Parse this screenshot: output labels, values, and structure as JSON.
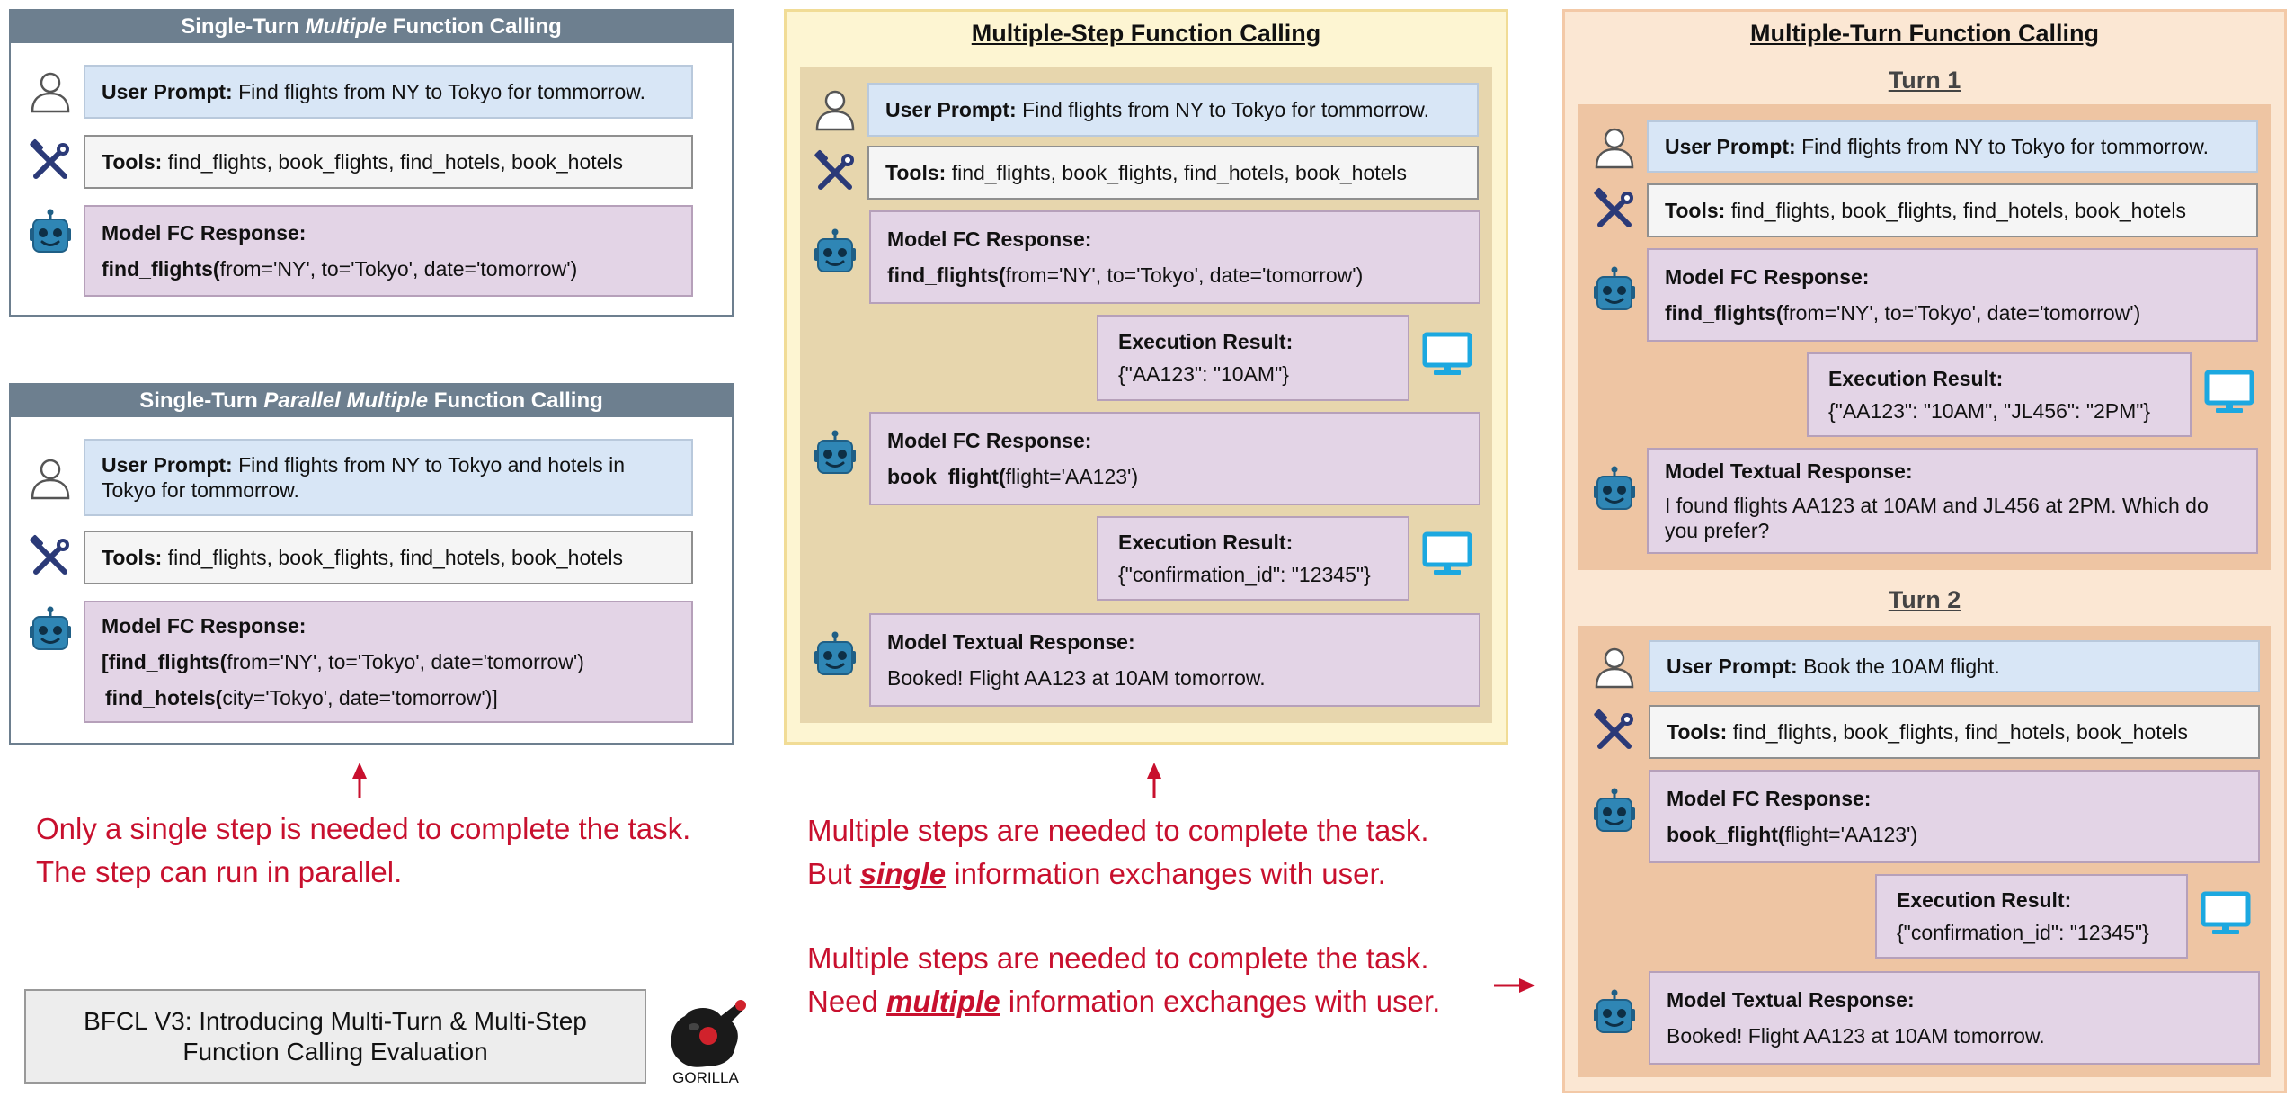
{
  "colors": {
    "note_red": "#c8102e",
    "robot_blue": "#2f86b5",
    "monitor_cyan": "#1ca8e0",
    "tools_navy": "#2b3a78",
    "card_header": "#6d7f8f"
  },
  "icons": {
    "user": "user-icon",
    "tools": "tools-icon",
    "robot": "robot-icon",
    "monitor": "monitor-icon",
    "gorilla": "gorilla-logo"
  },
  "labels": {
    "user_prompt": "User Prompt:",
    "tools": "Tools:",
    "model_fc": "Model FC Response:",
    "exec": "Execution Result:",
    "textual": "Model Textual Response:",
    "tools_list": "find_flights, book_flights, find_hotels, book_hotels"
  },
  "card1": {
    "title_a": "Single-Turn ",
    "title_b": "Multiple",
    "title_c": " Function Calling",
    "prompt": "Find flights from NY to Tokyo for tommorrow.",
    "fn": "find_flights(",
    "args": "from='NY', to='Tokyo', date='tomorrow')"
  },
  "card2": {
    "title_a": "Single-Turn ",
    "title_b": "Parallel Multiple",
    "title_c": " Function Calling",
    "prompt1": "Find flights from NY to Tokyo and hotels in",
    "prompt2": "Tokyo for tommorrow.",
    "l1_a": "[find_flights(",
    "l1_b": "from='NY', to='Tokyo', date='tomorrow')",
    "l2_a": "find_hotels(",
    "l2_b": "city='Tokyo', date='tomorrow')]"
  },
  "middle": {
    "title": "Multiple-Step Function Calling",
    "prompt": "Find flights from NY to Tokyo for tommorrow.",
    "fc1_fn": "find_flights(",
    "fc1_args": "from='NY', to='Tokyo', date='tomorrow')",
    "exec1": "{\"AA123\": \"10AM\"}",
    "fc2_fn": "book_flight(",
    "fc2_args": "flight='AA123')",
    "exec2": "{\"confirmation_id\": \"12345\"}",
    "text": "Booked! Flight AA123 at 10AM tomorrow."
  },
  "right": {
    "title": "Multiple-Turn Function Calling",
    "turn1": "Turn 1",
    "turn2": "Turn 2",
    "t1_prompt": "Find flights from NY to Tokyo for tommorrow.",
    "t1_fn": "find_flights(",
    "t1_args": "from='NY', to='Tokyo', date='tomorrow')",
    "t1_exec": "{\"AA123\": \"10AM\", \"JL456\": \"2PM\"}",
    "t1_text1": "I found flights AA123 at 10AM and JL456 at 2PM. Which do",
    "t1_text2": "you prefer?",
    "t2_prompt": "Book the 10AM flight.",
    "t2_fn": "book_flight(",
    "t2_args": "flight='AA123')",
    "t2_exec": "{\"confirmation_id\": \"12345\"}",
    "t2_text": "Booked! Flight AA123 at 10AM tomorrow."
  },
  "notes": {
    "n1_l1": "Only a single step is needed to complete the task.",
    "n1_l2": "The step can run in parallel.",
    "n2_l1": "Multiple steps are needed to complete the task.",
    "n2_l2a": "But ",
    "n2_l2b": "single",
    "n2_l2c": " information exchanges with user.",
    "n3_l1": "Multiple steps are needed to complete the task.",
    "n3_l2a": "Need ",
    "n3_l2b": "multiple",
    "n3_l2c": " information exchanges with user."
  },
  "footer": {
    "line1": "BFCL V3: Introducing Multi-Turn & Multi-Step",
    "line2": "Function Calling Evaluation"
  },
  "logo": {
    "text": "GORILLA"
  }
}
